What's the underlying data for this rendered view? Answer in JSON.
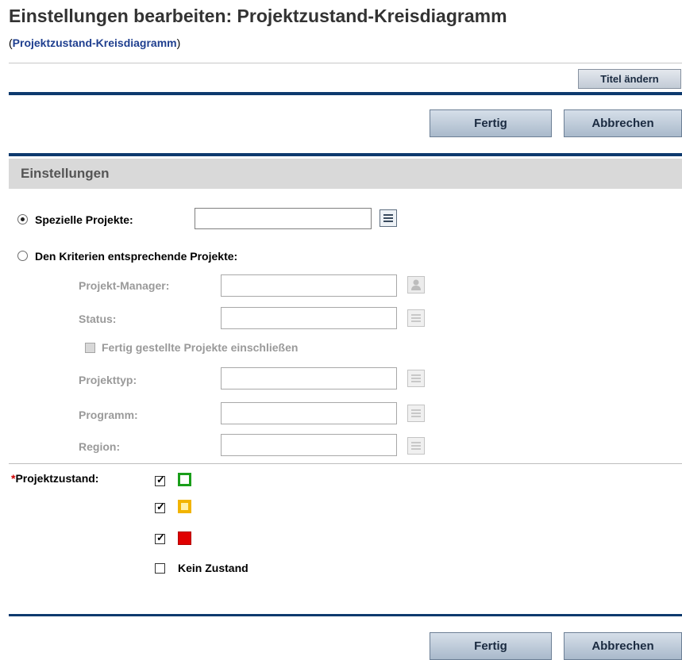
{
  "header": {
    "title": "Einstellungen bearbeiten: Projektzustand-Kreisdiagramm",
    "subtitle_open": "(",
    "subtitle_link": "Projektzustand-Kreisdiagramm",
    "subtitle_close": ")"
  },
  "toolbar": {
    "change_title_label": "Titel ändern",
    "done_label": "Fertig",
    "cancel_label": "Abbrechen"
  },
  "section": {
    "title": "Einstellungen"
  },
  "form": {
    "specific_projects": {
      "label": "Spezielle Projekte:",
      "value": "",
      "selected": true
    },
    "criteria_projects": {
      "label": "Den Kriterien entsprechende Projekte:",
      "selected": false
    },
    "project_manager": {
      "label": "Projekt-Manager:",
      "value": ""
    },
    "status": {
      "label": "Status:",
      "value": ""
    },
    "include_completed": {
      "label": "Fertig gestellte Projekte einschließen",
      "checked": false
    },
    "project_type": {
      "label": "Projekttyp:",
      "value": ""
    },
    "program": {
      "label": "Programm:",
      "value": ""
    },
    "region": {
      "label": "Region:",
      "value": ""
    }
  },
  "health": {
    "required_marker": "*",
    "label": "Projektzustand:",
    "options": [
      {
        "icon": "green-health-icon",
        "color": "#1a9e1a",
        "checked": true
      },
      {
        "icon": "yellow-health-icon",
        "color": "#f2b400",
        "checked": true
      },
      {
        "icon": "red-health-icon",
        "color": "#e00000",
        "checked": true
      },
      {
        "label": "Kein Zustand",
        "checked": false
      }
    ]
  },
  "footer": {
    "done_label": "Fertig",
    "cancel_label": "Abbrechen"
  }
}
